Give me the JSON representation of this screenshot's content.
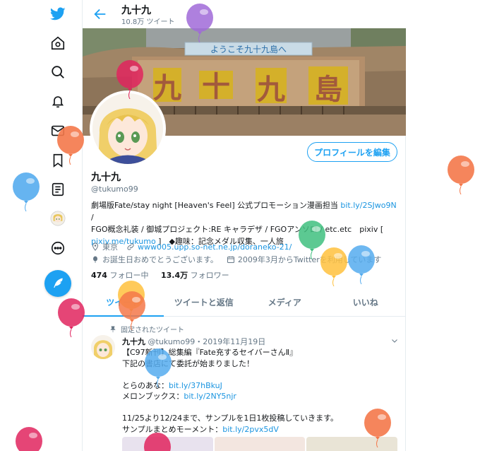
{
  "nav": {
    "items": [
      {
        "name": "twitter-logo-icon"
      },
      {
        "name": "home-icon"
      },
      {
        "name": "explore-icon"
      },
      {
        "name": "notifications-icon"
      },
      {
        "name": "messages-icon"
      },
      {
        "name": "bookmarks-icon"
      },
      {
        "name": "lists-icon"
      },
      {
        "name": "profile-icon"
      },
      {
        "name": "more-icon"
      }
    ],
    "tweet_button_icon": "feather-icon"
  },
  "header": {
    "name": "九十九",
    "tweet_count": "10.8万 ツイート"
  },
  "banner": {
    "sign_text": "ようこそ九十九島へ",
    "characters": [
      "九",
      "十",
      "九",
      "島"
    ]
  },
  "profile": {
    "edit_button": "プロフィールを編集",
    "display_name": "九十九",
    "handle": "@tukumo99",
    "bio": {
      "line1_text": "劇場版Fate/stay night [Heaven's Feel] 公式プロモーション漫画担当 ",
      "line1_link": "bit.ly/2SJwo9N",
      "line1_end": " /",
      "line2": "FGO概念礼装 / 御城プロジェクト:RE キャラデザ / FGOアンソロ / etc.etc　pixiv [",
      "line3_link": "pixiv.me/tukumo",
      "line3_text": " ]　◆趣味：記念メダル収集、一人旅"
    },
    "location": "東京",
    "website": "www005.upp.so-net.ne.jp/doraneko-21/",
    "birthday": "お誕生日おめでとうございます。",
    "joined": "2009年3月からTwitterを利用しています",
    "following_count": "474",
    "following_label": "フォロー中",
    "followers_count": "13.4万",
    "followers_label": "フォロワー"
  },
  "tabs": [
    {
      "label": "ツイート",
      "active": true
    },
    {
      "label": "ツイートと返信",
      "active": false
    },
    {
      "label": "メディア",
      "active": false
    },
    {
      "label": "いいね",
      "active": false
    }
  ],
  "pinned_tweet": {
    "pinned_label": "固定されたツイート",
    "name": "九十九",
    "handle": "@tukumo99",
    "date": "・2019年11月19日",
    "line1": "【C97新刊】総集編『Fate充するセイバーさんⅡ』",
    "line2": "下記の書店にて委託が始まりました！",
    "line3_text": "とらのあな：",
    "line3_link": "bit.ly/37hBkuJ",
    "line4_text": "メロンブックス：",
    "line4_link": "bit.ly/2NY5njr",
    "line5": "11/25より12/24まで、サンプルを1日1枚投稿していきます。",
    "line6_text": "サンプルまとめモーメント：",
    "line6_link": "bit.ly/2pvx5dV"
  },
  "colors": {
    "accent": "#1da1f2",
    "link": "#1b95e0",
    "secondary_text": "#657786",
    "balloon_purple": "#a06ad8",
    "balloon_pink": "#e0245e",
    "balloon_orange": "#f4784a",
    "balloon_blue": "#55acee",
    "balloon_green": "#3fbf7f",
    "balloon_yellow": "#ffc13d"
  }
}
